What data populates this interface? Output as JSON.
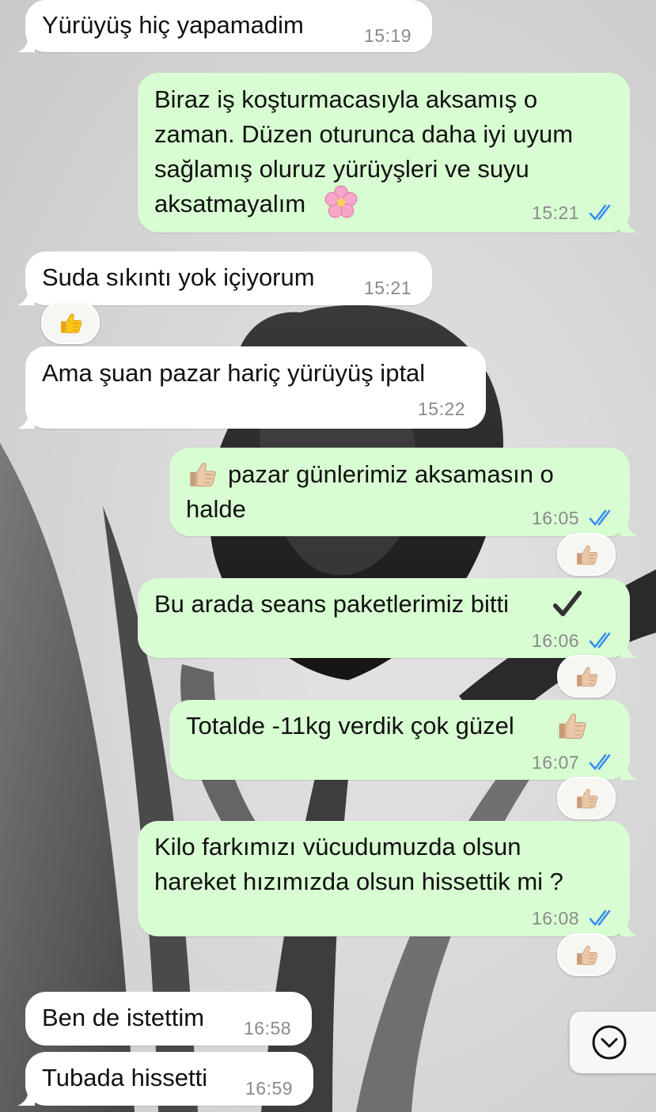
{
  "colors": {
    "incoming_bubble": "#ffffff",
    "outgoing_bubble": "#d8fdd2",
    "read_ticks": "#3b8ef0",
    "timestamp": "#8a8a8a"
  },
  "messages": [
    {
      "direction": "incoming",
      "text": "Yürüyüş hiç yapamadim",
      "time": "15:19"
    },
    {
      "direction": "outgoing",
      "text": "Biraz iş koşturmacasıyla aksamış o\nzaman. Düzen oturunca daha iyi uyum\nsağlamış oluruz yürüyşleri ve suyu\naksatmayalım",
      "trailing_emoji": "cherry-blossom",
      "time": "15:21",
      "status": "read"
    },
    {
      "direction": "incoming",
      "text": "Suda sıkıntı yok içiyorum",
      "time": "15:21",
      "reaction": "thumbs-up"
    },
    {
      "direction": "incoming",
      "text": "Ama şuan pazar hariç yürüyüş iptal",
      "time": "15:22"
    },
    {
      "direction": "outgoing",
      "leading_emoji": "thumbs-up-light",
      "text": "pazar günlerimiz aksamasın o\nhalde",
      "time": "16:05",
      "status": "read",
      "reaction": "thumbs-up-light"
    },
    {
      "direction": "outgoing",
      "text": "Bu arada seans paketlerimiz bitti",
      "trailing_emoji": "check-mark",
      "time": "16:06",
      "status": "read",
      "reaction": "thumbs-up-light"
    },
    {
      "direction": "outgoing",
      "text": "Totalde -11kg verdik çok güzel",
      "trailing_emoji": "thumbs-up-light",
      "time": "16:07",
      "status": "read",
      "reaction": "thumbs-up-light"
    },
    {
      "direction": "outgoing",
      "text": "Kilo farkımızı vücudumuzda olsun\nhareket hızımızda olsun hissettik mi ?",
      "time": "16:08",
      "status": "read",
      "reaction": "thumbs-up-light"
    },
    {
      "direction": "incoming",
      "text": "Ben de istettim",
      "time": "16:58"
    },
    {
      "direction": "incoming",
      "text": "Tubada hissetti",
      "time": "16:59"
    }
  ],
  "scroll_button": {
    "icon": "chevron-down-icon"
  }
}
